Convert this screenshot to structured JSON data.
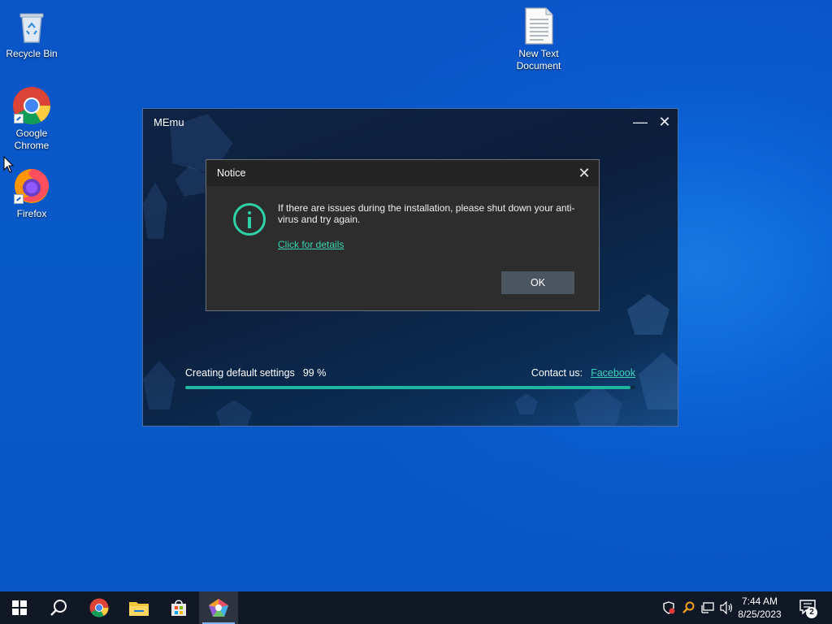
{
  "desktop": {
    "icons": [
      {
        "label": "Recycle Bin"
      },
      {
        "label": "Google Chrome"
      },
      {
        "label": "Firefox"
      },
      {
        "label": "New Text Document"
      }
    ]
  },
  "memu_window": {
    "title": "MEmu",
    "progress": {
      "label": "Creating default settings",
      "percent_text": "99 %",
      "value": 0.99
    },
    "contact": {
      "label": "Contact us:",
      "link": "Facebook"
    }
  },
  "notice_dialog": {
    "title": "Notice",
    "message": "If there are issues during the installation, please shut down your anti-virus and try again.",
    "link": "Click for details",
    "ok_label": "OK"
  },
  "taskbar": {
    "pinned": [
      "start-icon",
      "search-icon",
      "chrome-icon",
      "file-explorer-icon",
      "store-icon",
      "memu-icon"
    ],
    "clock_time": "7:44 AM",
    "clock_date": "8/25/2023",
    "notification_count": "2"
  },
  "colors": {
    "accent": "#2fd2a6",
    "link": "#3ad6b4",
    "progress": "#1fb5a0"
  }
}
